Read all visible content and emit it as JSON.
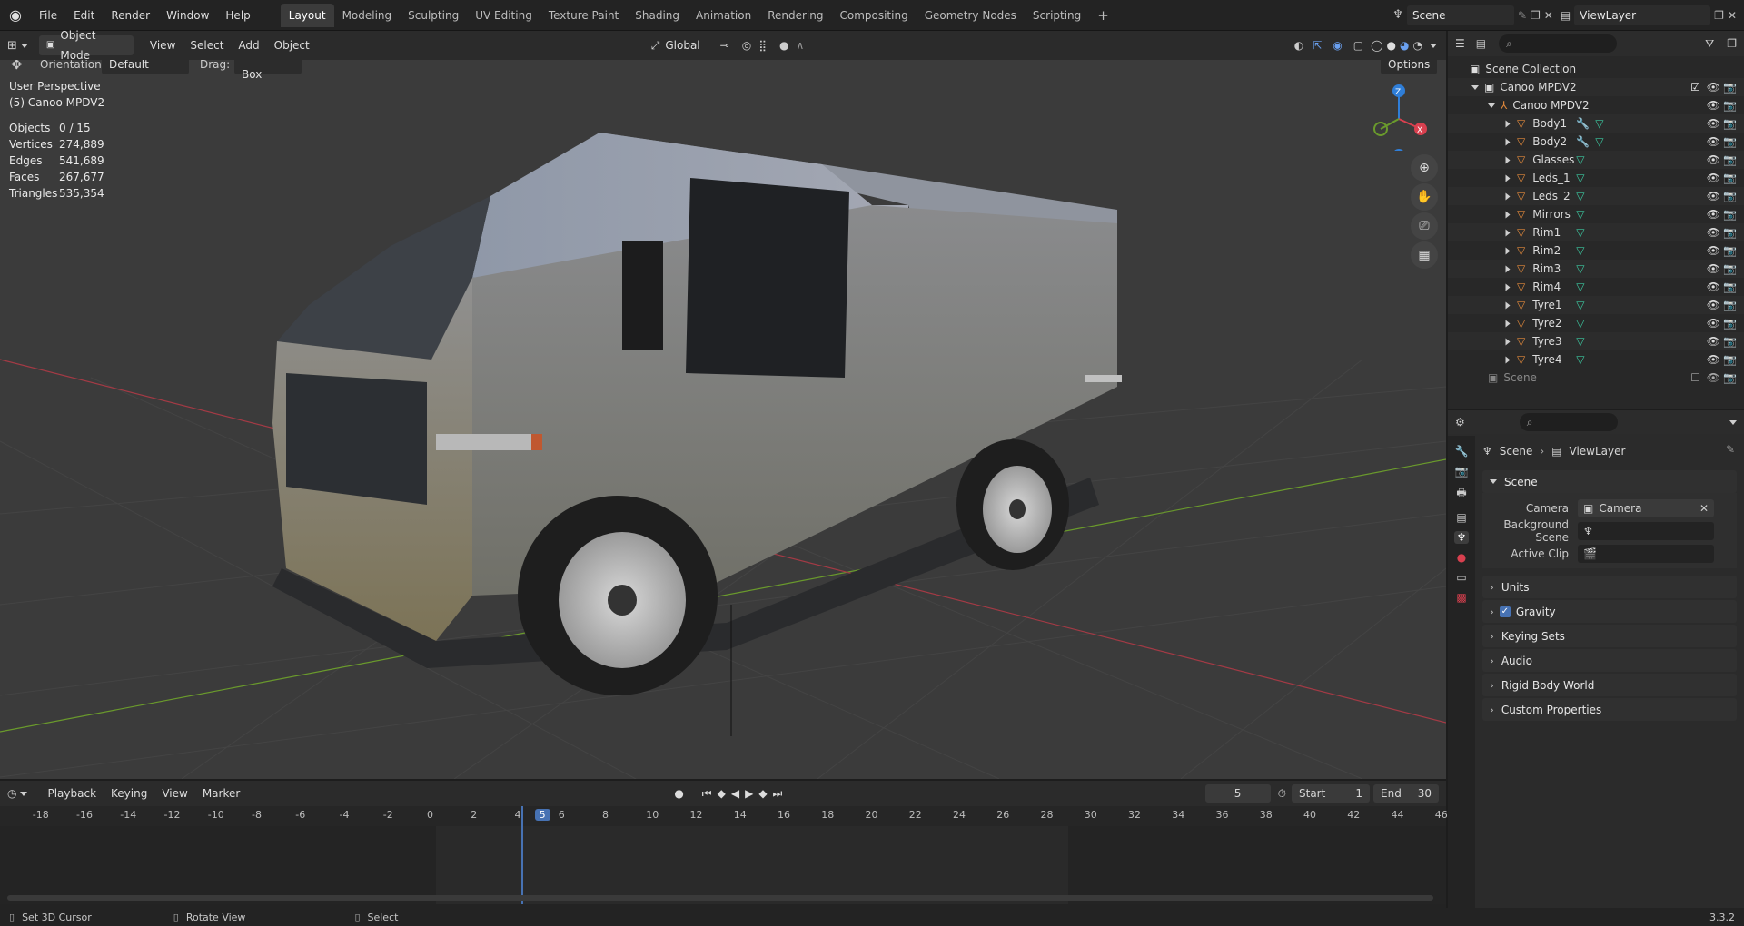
{
  "menubar": {
    "items": [
      "File",
      "Edit",
      "Render",
      "Window",
      "Help"
    ],
    "workspaces": [
      "Layout",
      "Modeling",
      "Sculpting",
      "UV Editing",
      "Texture Paint",
      "Shading",
      "Animation",
      "Rendering",
      "Compositing",
      "Geometry Nodes",
      "Scripting"
    ],
    "active_workspace": "Layout",
    "add_tab": "+",
    "scene_name": "Scene",
    "view_layer": "ViewLayer"
  },
  "viewport_header": {
    "mode": "Object Mode",
    "menus": [
      "View",
      "Select",
      "Add",
      "Object"
    ],
    "transform_orientation": "Global",
    "orientation_label": "Orientation:",
    "orientation_value": "Default",
    "drag_label": "Drag:",
    "drag_value": "Select Box",
    "options_label": "Options"
  },
  "viewport_info": {
    "perspective": "User Perspective",
    "collection": "(5) Canoo MPDV2",
    "stats": [
      {
        "label": "Objects",
        "value": "0 / 15"
      },
      {
        "label": "Vertices",
        "value": "274,889"
      },
      {
        "label": "Edges",
        "value": "541,689"
      },
      {
        "label": "Faces",
        "value": "267,677"
      },
      {
        "label": "Triangles",
        "value": "535,354"
      }
    ],
    "gizmo_axes": {
      "z": "Z",
      "x": "X"
    }
  },
  "outliner": {
    "root": "Scene Collection",
    "collection": "Canoo MPDV2",
    "empty": "Canoo MPDV2",
    "objects": [
      "Body1",
      "Body2",
      "Glasses",
      "Leds_1",
      "Leds_2",
      "Mirrors",
      "Rim1",
      "Rim2",
      "Rim3",
      "Rim4",
      "Tyre1",
      "Tyre2",
      "Tyre3",
      "Tyre4"
    ],
    "scene_item": "Scene"
  },
  "properties": {
    "breadcrumb_scene": "Scene",
    "breadcrumb_layer": "ViewLayer",
    "panel_title": "Scene",
    "camera_label": "Camera",
    "camera_value": "Camera",
    "background_scene_label": "Background Scene",
    "active_clip_label": "Active Clip",
    "subpanels": [
      "Units",
      "Gravity",
      "Keying Sets",
      "Audio",
      "Rigid Body World",
      "Custom Properties"
    ],
    "gravity_checked": true
  },
  "timeline": {
    "menus": [
      "Playback",
      "Keying",
      "View",
      "Marker"
    ],
    "current_frame": "5",
    "start_label": "Start",
    "start_value": "1",
    "end_label": "End",
    "end_value": "30",
    "ticks": [
      "-18",
      "-16",
      "-14",
      "-12",
      "-10",
      "-8",
      "-6",
      "-4",
      "-2",
      "0",
      "2",
      "4",
      "5",
      "6",
      "8",
      "10",
      "12",
      "14",
      "16",
      "18",
      "20",
      "22",
      "24",
      "26",
      "28",
      "30",
      "32",
      "34",
      "36",
      "38",
      "40",
      "42",
      "44",
      "46"
    ]
  },
  "statusbar": {
    "hint1": "Set 3D Cursor",
    "hint2": "Rotate View",
    "hint3": "Select",
    "version": "3.3.2"
  },
  "colors": {
    "accent": "#4772b3",
    "axis_x": "#d9404f",
    "axis_y": "#6a9a2c",
    "axis_z": "#2f7ed8",
    "mesh_icon": "#e0883b",
    "data_icon": "#3cc8a0"
  }
}
